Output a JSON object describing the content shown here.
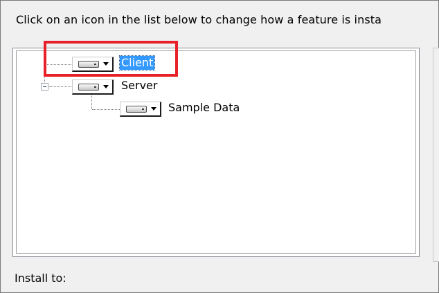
{
  "instruction": "Click on an icon in the list below to change how a feature is insta",
  "tree": {
    "nodes": [
      {
        "label": "Client",
        "selected": true,
        "icon": "drive-icon"
      },
      {
        "label": "Server",
        "selected": false,
        "icon": "drive-icon",
        "expanded": true
      },
      {
        "label": "Sample Data",
        "selected": false,
        "icon": "drive-icon"
      }
    ]
  },
  "install_to_label": "Install to:",
  "colors": {
    "selection": "#3399ff",
    "highlight_box": "#e8202a"
  }
}
